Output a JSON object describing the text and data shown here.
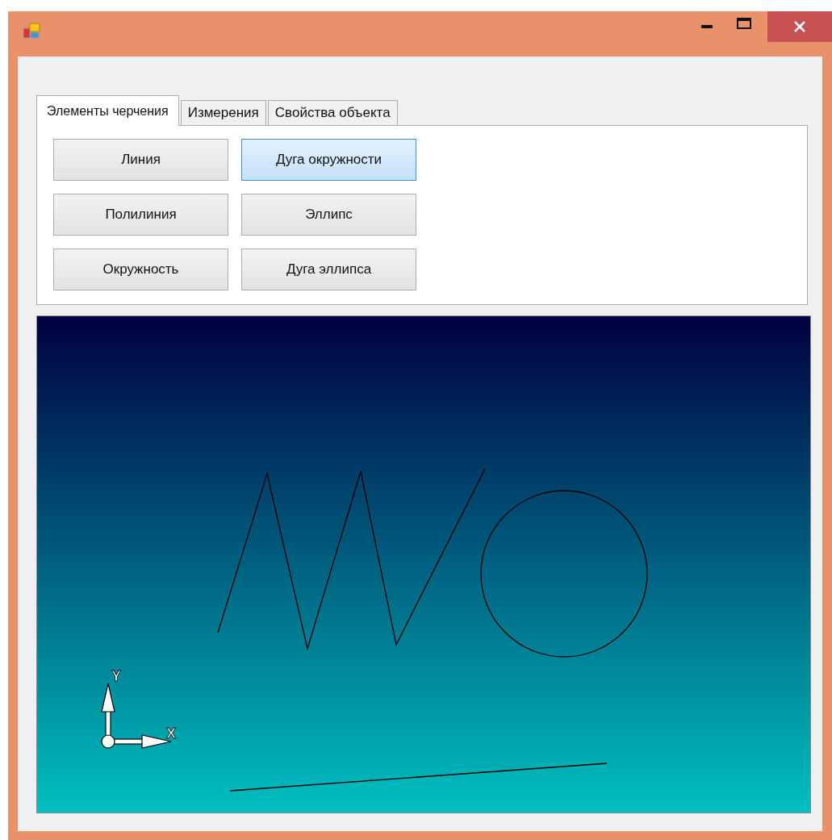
{
  "window": {
    "title_bar": {
      "buttons": [
        {
          "kind": "minimize"
        },
        {
          "kind": "maximize"
        },
        {
          "kind": "close"
        }
      ]
    }
  },
  "tabs": [
    {
      "label": "Элементы черчения",
      "selected": true
    },
    {
      "label": "Измерения",
      "selected": false
    },
    {
      "label": "Свойства объекта",
      "selected": false
    }
  ],
  "tool_buttons": [
    {
      "label": "Линия",
      "highlighted": false
    },
    {
      "label": "Дуга окружности",
      "highlighted": true
    },
    {
      "label": "Полилиния",
      "highlighted": false
    },
    {
      "label": "Эллипс",
      "highlighted": false
    },
    {
      "label": "Окружность",
      "highlighted": false
    },
    {
      "label": "Дуга эллипса",
      "highlighted": false
    }
  ],
  "canvas": {
    "axis_labels": {
      "x": "X",
      "y": "Y"
    }
  }
}
